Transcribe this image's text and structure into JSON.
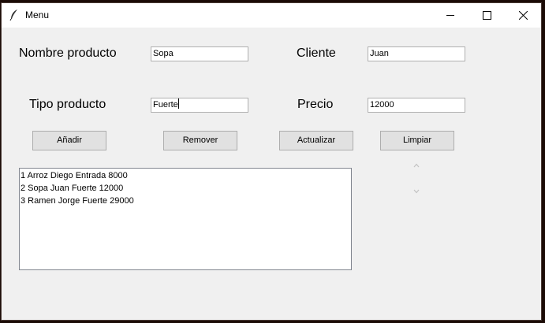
{
  "window": {
    "title": "Menu"
  },
  "form": {
    "nombre_label": "Nombre producto",
    "nombre_value": "Sopa",
    "cliente_label": "Cliente",
    "cliente_value": "Juan",
    "tipo_label": "Tipo producto",
    "tipo_value": "Fuerte",
    "precio_label": "Precio",
    "precio_value": "12000"
  },
  "buttons": {
    "anadir": "Añadir",
    "remover": "Remover",
    "actualizar": "Actualizar",
    "limpiar": "Limpiar"
  },
  "list": {
    "items": [
      "1 Arroz Diego Entrada 8000",
      "2 Sopa Juan Fuerte 12000",
      "3 Ramen Jorge Fuerte 29000"
    ]
  },
  "icons": {
    "app": "feather-icon",
    "minimize": "minimize-icon",
    "maximize": "maximize-icon",
    "close": "close-icon",
    "scroll_up": "chevron-up-icon",
    "scroll_down": "chevron-down-icon"
  }
}
